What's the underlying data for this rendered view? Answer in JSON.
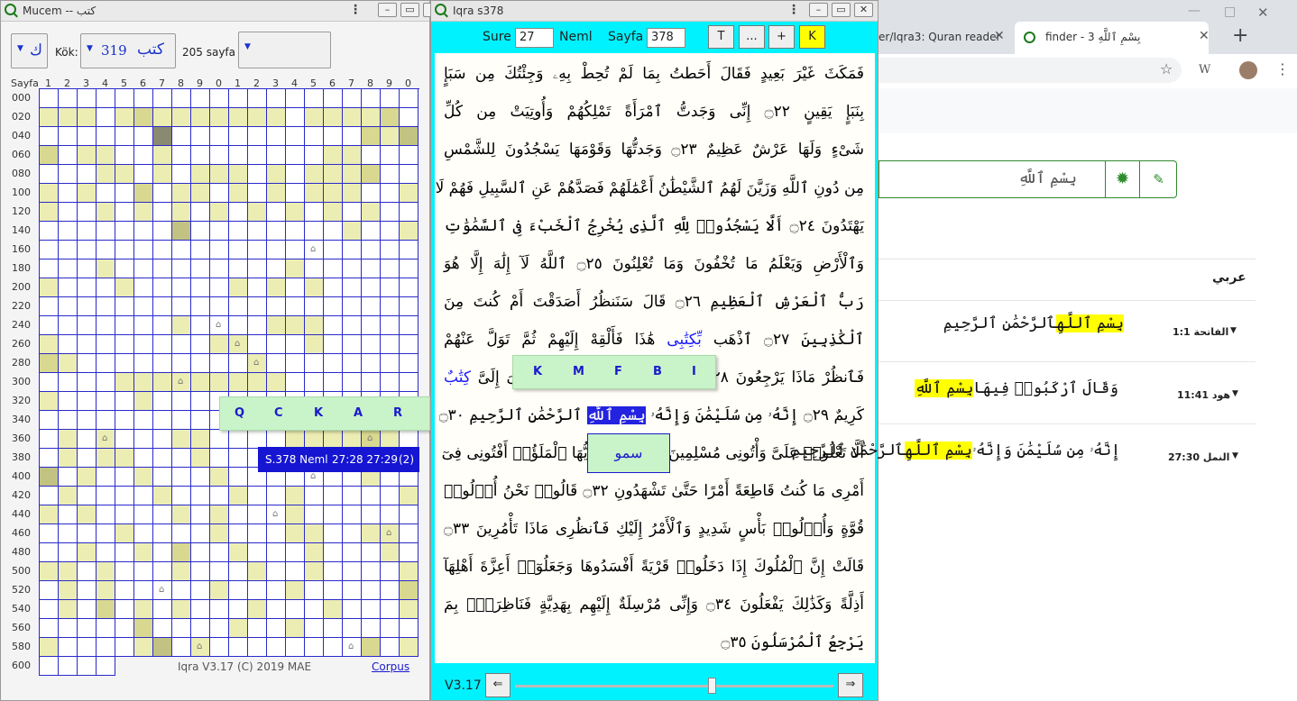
{
  "mucem": {
    "title": "Mucem -- كتب",
    "root_label": "Kök:",
    "root_button": "ك",
    "root_number": "319",
    "root_word": "كتب",
    "pages_text": "205 sayfa",
    "col_header_label": "Sayfa",
    "col_headers": [
      "1",
      "2",
      "3",
      "4",
      "5",
      "6",
      "7",
      "8",
      "9",
      "0",
      "1",
      "2",
      "3",
      "4",
      "5",
      "6",
      "7",
      "8",
      "9",
      "0"
    ],
    "row_labels": [
      "000",
      "020",
      "040",
      "060",
      "080",
      "100",
      "120",
      "140",
      "160",
      "180",
      "200",
      "220",
      "240",
      "260",
      "280",
      "300",
      "320",
      "340",
      "360",
      "380",
      "400",
      "420",
      "440",
      "460",
      "480",
      "500",
      "520",
      "540",
      "560",
      "580",
      "600"
    ],
    "footer": "Iqra V3.17 (C) 2019 MAE",
    "corpus_link": "Corpus",
    "popup_letters": [
      "Q",
      "C",
      "K",
      "A",
      "R"
    ],
    "tooltip_left": "S.378 Neml",
    "tooltip_mid": "27:28 27:29",
    "tooltip_right": "(2)"
  },
  "iqra": {
    "title": "Iqra s378",
    "sure_label": "Sure",
    "sure_value": "27",
    "sure_name": "Neml",
    "page_label": "Sayfa",
    "page_value": "378",
    "buttons": [
      "T",
      "...",
      "+",
      "K"
    ],
    "version": "V3.17",
    "prev_arrow": "⇐",
    "next_arrow": "⇒",
    "popup_letters": [
      "K",
      "M",
      "F",
      "B",
      "I"
    ],
    "popup_word": "سمو",
    "lines": [
      "فَمَكَثَ غَيْرَ بَعِيدٍ فَقَالَ أَحَطتُ بِمَا لَمْ تُحِطْ بِهِۦ وَجِئْتُكَ مِن سَبَإٍ",
      "بِنَبَإٍ يَقِينٍ ۝٢٢ إِنِّى وَجَدتُّ ٱمْرَأَةً تَمْلِكُهُمْ وَأُوتِيَتْ مِن كُلِّ",
      "شَىْءٍ وَلَهَا عَرْشٌ عَظِيمٌ ۝٢٣ وَجَدتُّهَا وَقَوْمَهَا يَسْجُدُونَ لِلشَّمْسِ",
      "مِن دُونِ ٱللَّهِ وَزَيَّنَ لَهُمُ ٱلشَّيْطَٰنُ أَعْمَٰلَهُمْ فَصَدَّهُمْ عَنِ ٱلسَّبِيلِ فَهُمْ لَا",
      "يَهْتَدُونَ ۝٢٤ أَلَّا يَسْجُدُوا۟ لِلَّهِ ٱلَّذِى يُخْرِجُ ٱلْخَبْءَ فِى ٱلسَّمَٰوَٰتِ",
      "وَٱلْأَرْضِ وَيَعْلَمُ مَا تُخْفُونَ وَمَا تُعْلِنُونَ ۝٢٥ ٱللَّهُ لَآ إِلَٰهَ إِلَّا هُوَ",
      "رَبُّ ٱلْعَرْشِ ٱلْعَظِيمِ ۝٢٦ قَالَ سَنَنظُرُ أَصَدَقْتَ أَمْ كُنتَ مِنَ",
      "ٱلْكَٰذِبِينَ ۝٢٧ ٱذْهَب",
      "بِّكِتَٰبِى",
      "هَٰذَا فَأَلْقِهْ إِلَيْهِمْ ثُمَّ تَوَلَّ عَنْهُمْ",
      "فَٱنظُرْ مَاذَا يَرْجِعُونَ ۝٢٨ قَالَتْ يَٰٓأَيُّهَا ٱلْمَلَؤُا۟ إِنِّىٓ أُلْقِىَ إِلَىَّ",
      "كِتَٰبٌ",
      "كَرِيمٌ ۝٢٩ إِنَّهُۥ مِن سُلَيْمَٰنَ وَإِنَّهُۥ",
      "بِسْمِ ٱللَّهِ",
      "ٱلرَّحْمَٰنِ ٱلرَّحِيمِ ۝٣٠",
      "أَلَّا تَعْلُوا۟ عَلَىَّ وَأْتُونِى مُسْلِمِينَ ۝٣١ قَالَتْ يَٰٓأَيُّهَا ٱلْمَلَؤُا۟ أَفْتُونِى فِىٓ",
      "أَمْرِى مَا كُنتُ قَاطِعَةً أَمْرًا حَتَّىٰ تَشْهَدُونِ ۝٣٢ قَالُوا۟ نَحْنُ أُو۟لُوا۟",
      "قُوَّةٍ وَأُو۟لُوا۟ بَأْسٍ شَدِيدٍ وَٱلْأَمْرُ إِلَيْكِ فَٱنظُرِى مَاذَا تَأْمُرِينَ ۝٣٣",
      "قَالَتْ إِنَّ ٱلْمُلُوكَ إِذَا دَخَلُوا۟ قَرْيَةً أَفْسَدُوهَا وَجَعَلُوٓا۟ أَعِزَّةَ أَهْلِهَآ",
      "أَذِلَّةً وَكَذَٰلِكَ يَفْعَلُونَ ۝٣٤ وَإِنِّى مُرْسِلَةٌ إِلَيْهِم بِهَدِيَّةٍ فَنَاظِرَةٌۢ بِمَ",
      "يَرْجِعُ ٱلْمُرْسَلُونَ ۝٣٥"
    ]
  },
  "browser": {
    "tab1": "er/Iqra3: Quran reader",
    "tab2": "finder - 3 بِسْمِ ٱللَّهِ",
    "new_tab": "+",
    "search_value": "بِسْمِ ٱللَّهِ",
    "heading": "عربي",
    "results": [
      {
        "ref": "الفاتحة 1:1",
        "pre": "",
        "hl": "بِسْمِ ٱللَّهِ",
        "post": "ٱلرَّحْمَٰنِ ٱلرَّحِيمِ"
      },
      {
        "ref": "هود 11:41",
        "pre": "وَقَالَ ٱرْكَبُوا۟ فِيهَا",
        "hl": "بِسْمِ ٱللَّهِ",
        "post": ""
      },
      {
        "ref": "النمل 27:30",
        "pre": "إِنَّهُۥ مِن سُلَيْمَٰنَ وَإِنَّهُۥ",
        "hl": "بِسْمِ ٱللَّهِ",
        "post": "ٱلرَّحْمَٰنِ ٱلرَّحِيمِ"
      }
    ]
  },
  "colors": {
    "cyan": "#00f2ff",
    "grid_line": "#2a2acb",
    "highlight": "#ffff00",
    "popup": "#c9f3c9",
    "selection": "#2323e0"
  }
}
